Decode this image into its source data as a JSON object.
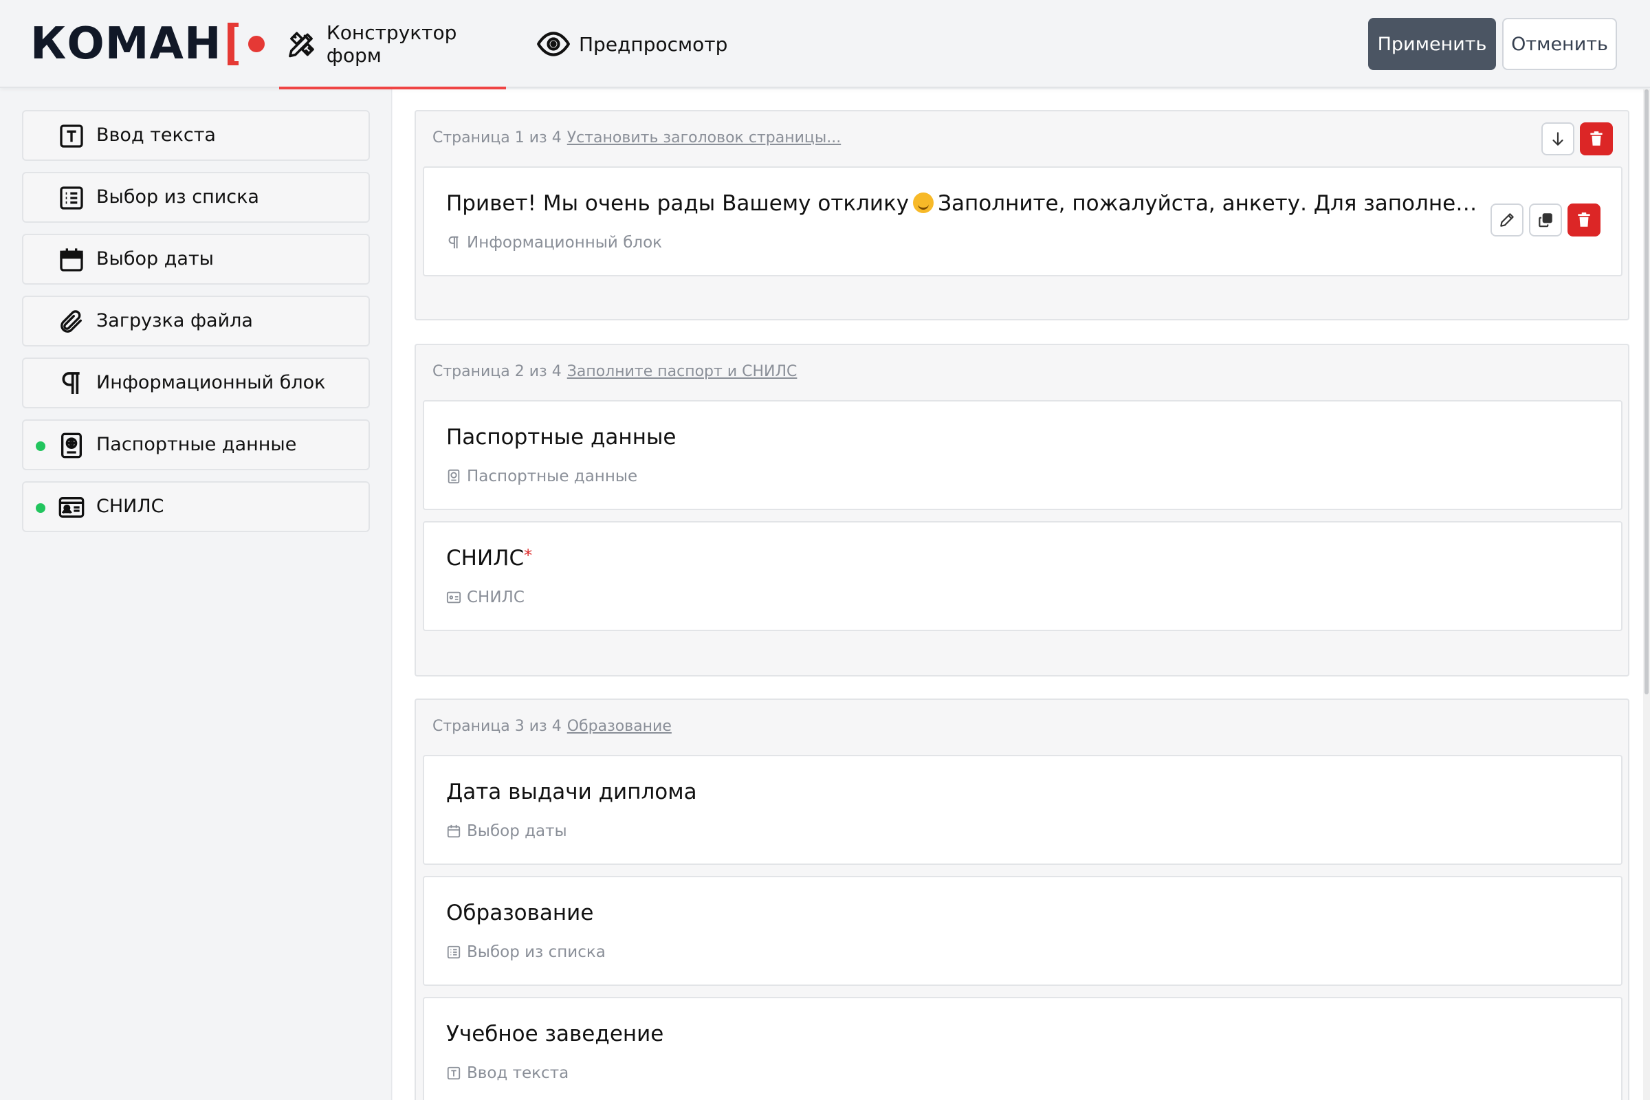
{
  "app": {
    "logo_text": "КОМАН",
    "tabs": [
      {
        "label": "Конструктор форм",
        "icon": "pencil-ruler-icon",
        "active": true
      },
      {
        "label": "Предпросмотр",
        "icon": "eye-icon",
        "active": false
      }
    ],
    "apply_label": "Применить",
    "cancel_label": "Отменить"
  },
  "palette": [
    {
      "label": "Ввод текста",
      "icon": "text-input-icon",
      "used": false
    },
    {
      "label": "Выбор из списка",
      "icon": "list-icon",
      "used": false
    },
    {
      "label": "Выбор даты",
      "icon": "calendar-icon",
      "used": false
    },
    {
      "label": "Загрузка файла",
      "icon": "paperclip-icon",
      "used": false
    },
    {
      "label": "Информационный блок",
      "icon": "paragraph-icon",
      "used": false
    },
    {
      "label": "Паспортные данные",
      "icon": "passport-icon",
      "used": true
    },
    {
      "label": "СНИЛС",
      "icon": "id-card-icon",
      "used": true
    }
  ],
  "pages": [
    {
      "caption": "Страница 1 из 4",
      "title": "Установить заголовок страницы...",
      "fields": [
        {
          "title_before": "Привет! Мы очень рады Вашему отклику",
          "title_after": "Заполните, пожалуйста, анкету. Для заполнения по...",
          "type": "Информационный блок",
          "type_icon": "paragraph-icon",
          "required": false
        }
      ]
    },
    {
      "caption": "Страница 2 из 4",
      "title": "Заполните паспорт и СНИЛС",
      "fields": [
        {
          "title": "Паспортные данные",
          "type": "Паспортные данные",
          "type_icon": "passport-icon",
          "required": false
        },
        {
          "title": "СНИЛС",
          "type": "СНИЛС",
          "type_icon": "id-card-icon",
          "required": true,
          "required_mark": "*"
        }
      ]
    },
    {
      "caption": "Страница 3 из 4",
      "title": "Образование",
      "fields": [
        {
          "title": "Дата выдачи диплома",
          "type": "Выбор даты",
          "type_icon": "calendar-icon",
          "required": false
        },
        {
          "title": "Образование",
          "type": "Выбор из списка",
          "type_icon": "list-icon",
          "required": false
        },
        {
          "title": "Учебное заведение",
          "type": "Ввод текста",
          "type_icon": "text-input-icon",
          "required": false
        }
      ]
    }
  ],
  "colors": {
    "accent_red": "#ef4444",
    "danger": "#dc2626",
    "apply_bg": "#4b5563",
    "used_dot": "#22c55e"
  }
}
